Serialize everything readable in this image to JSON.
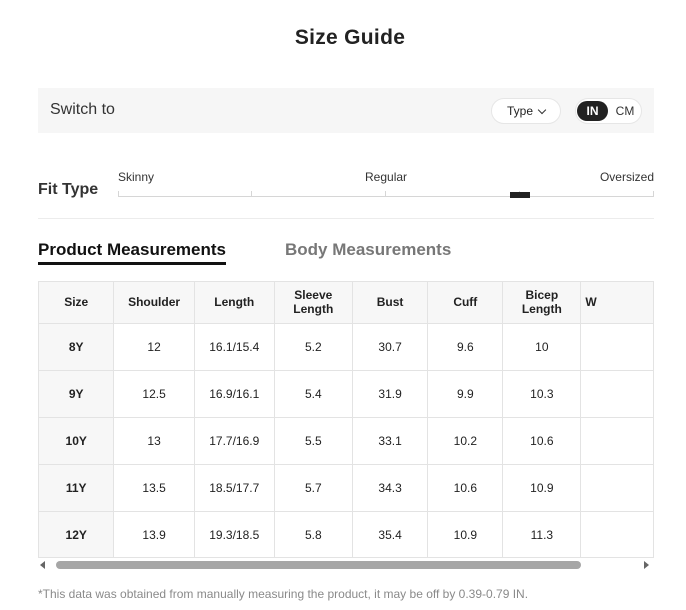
{
  "title": "Size Guide",
  "switch_bar": {
    "label": "Switch to",
    "type_select": "Type",
    "units": [
      "IN",
      "CM"
    ],
    "selected_unit": "IN"
  },
  "fit_type": {
    "label": "Fit Type",
    "options": [
      "Skinny",
      "Regular",
      "Oversized"
    ],
    "selected_position": 0.75
  },
  "tabs": [
    {
      "label": "Product Measurements",
      "active": true
    },
    {
      "label": "Body Measurements",
      "active": false
    }
  ],
  "table": {
    "headers": [
      "Size",
      "Shoulder",
      "Length",
      "Sleeve Length",
      "Bust",
      "Cuff",
      "Bicep Length",
      "W"
    ],
    "rows": [
      [
        "8Y",
        "12",
        "16.1/15.4",
        "5.2",
        "30.7",
        "9.6",
        "10",
        ""
      ],
      [
        "9Y",
        "12.5",
        "16.9/16.1",
        "5.4",
        "31.9",
        "9.9",
        "10.3",
        ""
      ],
      [
        "10Y",
        "13",
        "17.7/16.9",
        "5.5",
        "33.1",
        "10.2",
        "10.6",
        ""
      ],
      [
        "11Y",
        "13.5",
        "18.5/17.7",
        "5.7",
        "34.3",
        "10.6",
        "10.9",
        ""
      ],
      [
        "12Y",
        "13.9",
        "19.3/18.5",
        "5.8",
        "35.4",
        "10.9",
        "11.3",
        ""
      ]
    ]
  },
  "footnote": "*This data was obtained from manually measuring the product, it may be off by 0.39-0.79 IN.",
  "colors": {
    "accent": "#222222",
    "bar_bg": "#f6f6f6",
    "border": "#e3e3e3",
    "muted_text": "#8a8a8a"
  }
}
